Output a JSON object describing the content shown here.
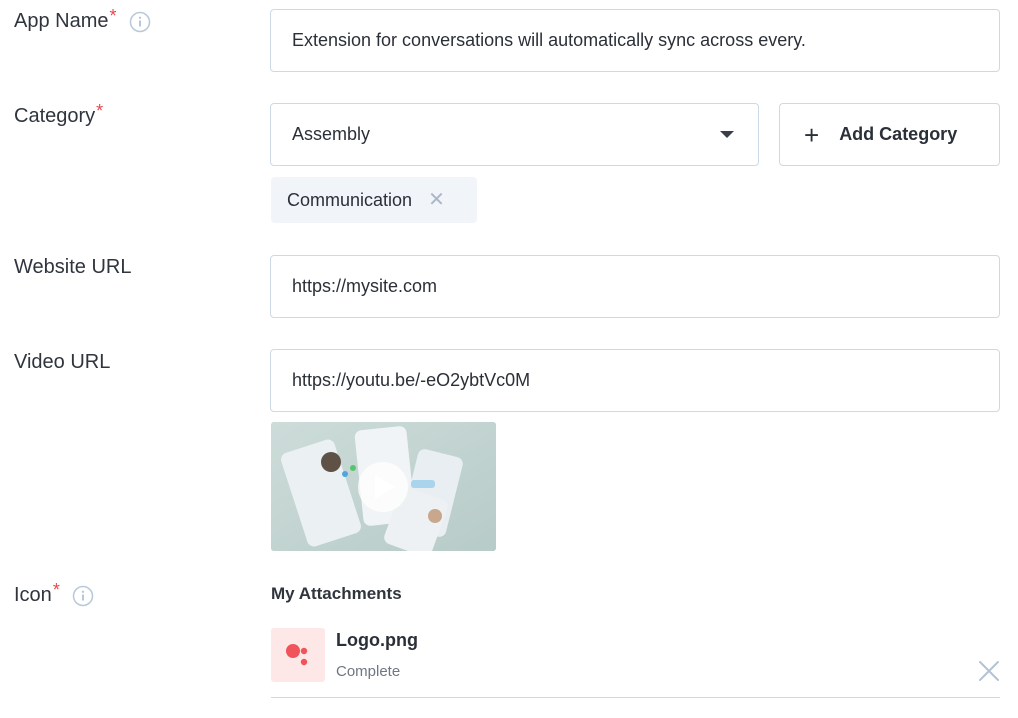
{
  "app_name": {
    "label": "App Name",
    "required_mark": "*",
    "value": "Extension for conversations will automatically sync across every."
  },
  "category": {
    "label": "Category",
    "required_mark": "*",
    "selected": "Assembly",
    "add_button_icon": "+",
    "add_button_label": "Add Category",
    "chips": [
      {
        "label": "Communication",
        "remove_icon": "✕"
      }
    ]
  },
  "website_url": {
    "label": "Website URL",
    "value": "https://mysite.com"
  },
  "video_url": {
    "label": "Video URL",
    "value": "https://youtu.be/-eO2ybtVc0M"
  },
  "icon_field": {
    "label": "Icon",
    "required_mark": "*",
    "attachments_title": "My Attachments",
    "attachments": [
      {
        "name": "Logo.png",
        "status": "Complete"
      }
    ]
  },
  "colors": {
    "required": "#e5484d",
    "border": "#cdd9e6",
    "chip_bg": "#f1f4f8",
    "file_icon_bg": "#fde7e7",
    "file_icon_dots": "#f0535a"
  }
}
